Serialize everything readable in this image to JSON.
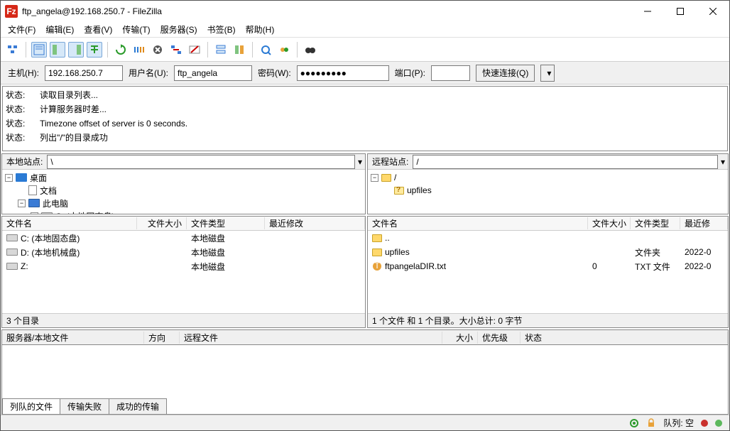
{
  "titlebar": {
    "title": "ftp_angela@192.168.250.7 - FileZilla"
  },
  "menu": [
    "文件(F)",
    "编辑(E)",
    "查看(V)",
    "传输(T)",
    "服务器(S)",
    "书签(B)",
    "帮助(H)"
  ],
  "quickbar": {
    "host_label": "主机(H):",
    "host": "192.168.250.7",
    "user_label": "用户名(U):",
    "user": "ftp_angela",
    "pass_label": "密码(W):",
    "pass": "●●●●●●●●●",
    "port_label": "端口(P):",
    "port": "",
    "connect": "快速连接(Q)"
  },
  "log": [
    {
      "k": "状态:",
      "v": "读取目录列表..."
    },
    {
      "k": "状态:",
      "v": "计算服务器时差..."
    },
    {
      "k": "状态:",
      "v": "Timezone offset of server is 0 seconds."
    },
    {
      "k": "状态:",
      "v": "列出\"/\"的目录成功"
    }
  ],
  "local": {
    "label": "本地站点:",
    "path": "\\",
    "tree": [
      {
        "ind": 0,
        "exp": "-",
        "icon": "desk",
        "text": "桌面"
      },
      {
        "ind": 1,
        "exp": "",
        "icon": "doc",
        "text": "文档"
      },
      {
        "ind": 1,
        "exp": "-",
        "icon": "pc",
        "text": "此电脑"
      },
      {
        "ind": 2,
        "exp": "+",
        "icon": "drive",
        "text": "C: (本地固态盘)"
      }
    ],
    "cols": {
      "name": "文件名",
      "size": "文件大小",
      "type": "文件类型",
      "mod": "最近修改"
    },
    "rows": [
      {
        "icon": "drive",
        "name": "C: (本地固态盘)",
        "size": "",
        "type": "本地磁盘",
        "mod": ""
      },
      {
        "icon": "drive",
        "name": "D: (本地机械盘)",
        "size": "",
        "type": "本地磁盘",
        "mod": ""
      },
      {
        "icon": "drive",
        "name": "Z:",
        "size": "",
        "type": "本地磁盘",
        "mod": ""
      }
    ],
    "status": "3 个目录"
  },
  "remote": {
    "label": "远程站点:",
    "path": "/",
    "tree": [
      {
        "ind": 0,
        "exp": "-",
        "icon": "folder",
        "text": "/"
      },
      {
        "ind": 1,
        "exp": "",
        "icon": "folderq",
        "text": "upfiles"
      }
    ],
    "cols": {
      "name": "文件名",
      "size": "文件大小",
      "type": "文件类型",
      "mod": "最近修"
    },
    "rows": [
      {
        "icon": "folder",
        "name": "..",
        "size": "",
        "type": "",
        "mod": ""
      },
      {
        "icon": "folder",
        "name": "upfiles",
        "size": "",
        "type": "文件夹",
        "mod": "2022-0"
      },
      {
        "icon": "txt",
        "name": "ftpangelaDIR.txt",
        "size": "0",
        "type": "TXT 文件",
        "mod": "2022-0"
      }
    ],
    "status": "1 个文件 和 1 个目录。大小总计: 0 字节"
  },
  "queue": {
    "cols": [
      "服务器/本地文件",
      "方向",
      "远程文件",
      "大小",
      "优先级",
      "状态"
    ],
    "tabs": [
      "列队的文件",
      "传输失败",
      "成功的传输"
    ]
  },
  "statusbar": {
    "queue": "队列: 空"
  }
}
